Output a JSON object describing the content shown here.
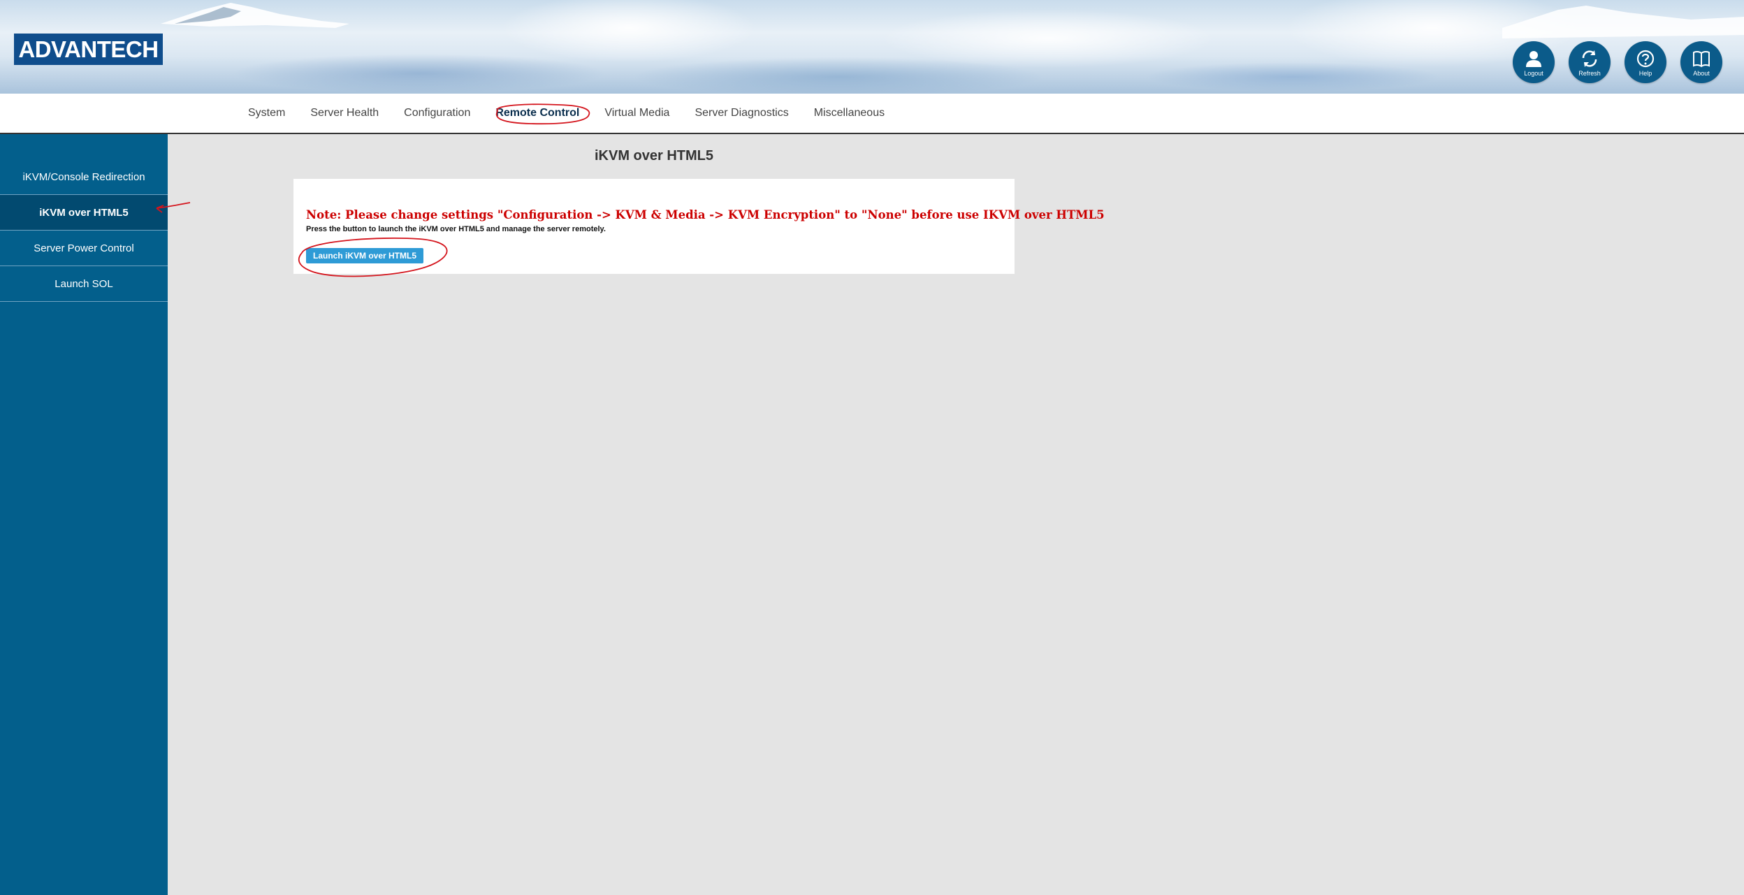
{
  "header": {
    "logo_text": "ADVANTECH",
    "actions": [
      {
        "label": "Logout",
        "icon": "user-icon"
      },
      {
        "label": "Refresh",
        "icon": "refresh-icon"
      },
      {
        "label": "Help",
        "icon": "help-icon"
      },
      {
        "label": "About",
        "icon": "book-icon"
      }
    ]
  },
  "nav": {
    "items": [
      "System",
      "Server Health",
      "Configuration",
      "Remote Control",
      "Virtual Media",
      "Server Diagnostics",
      "Miscellaneous"
    ],
    "active": "Remote Control"
  },
  "sidebar": {
    "items": [
      "iKVM/Console Redirection",
      "iKVM over HTML5",
      "Server Power Control",
      "Launch SOL"
    ],
    "active": "iKVM over HTML5"
  },
  "main": {
    "title": "iKVM over HTML5",
    "note": "Note: Please change settings \"Configuration -> KVM & Media -> KVM Encryption\" to \"None\" before use IKVM over HTML5",
    "description": "Press the button to launch the iKVM over HTML5 and manage the server remotely.",
    "launch_button": "Launch iKVM over HTML5"
  },
  "colors": {
    "brand": "#0f4d8c",
    "sidebar": "#035f8c",
    "sidebar_active": "#024a70",
    "action_button": "#0b5b8a",
    "note_text": "#cc0000",
    "launch_button": "#2e9bd6",
    "annotation": "#d4141c"
  }
}
